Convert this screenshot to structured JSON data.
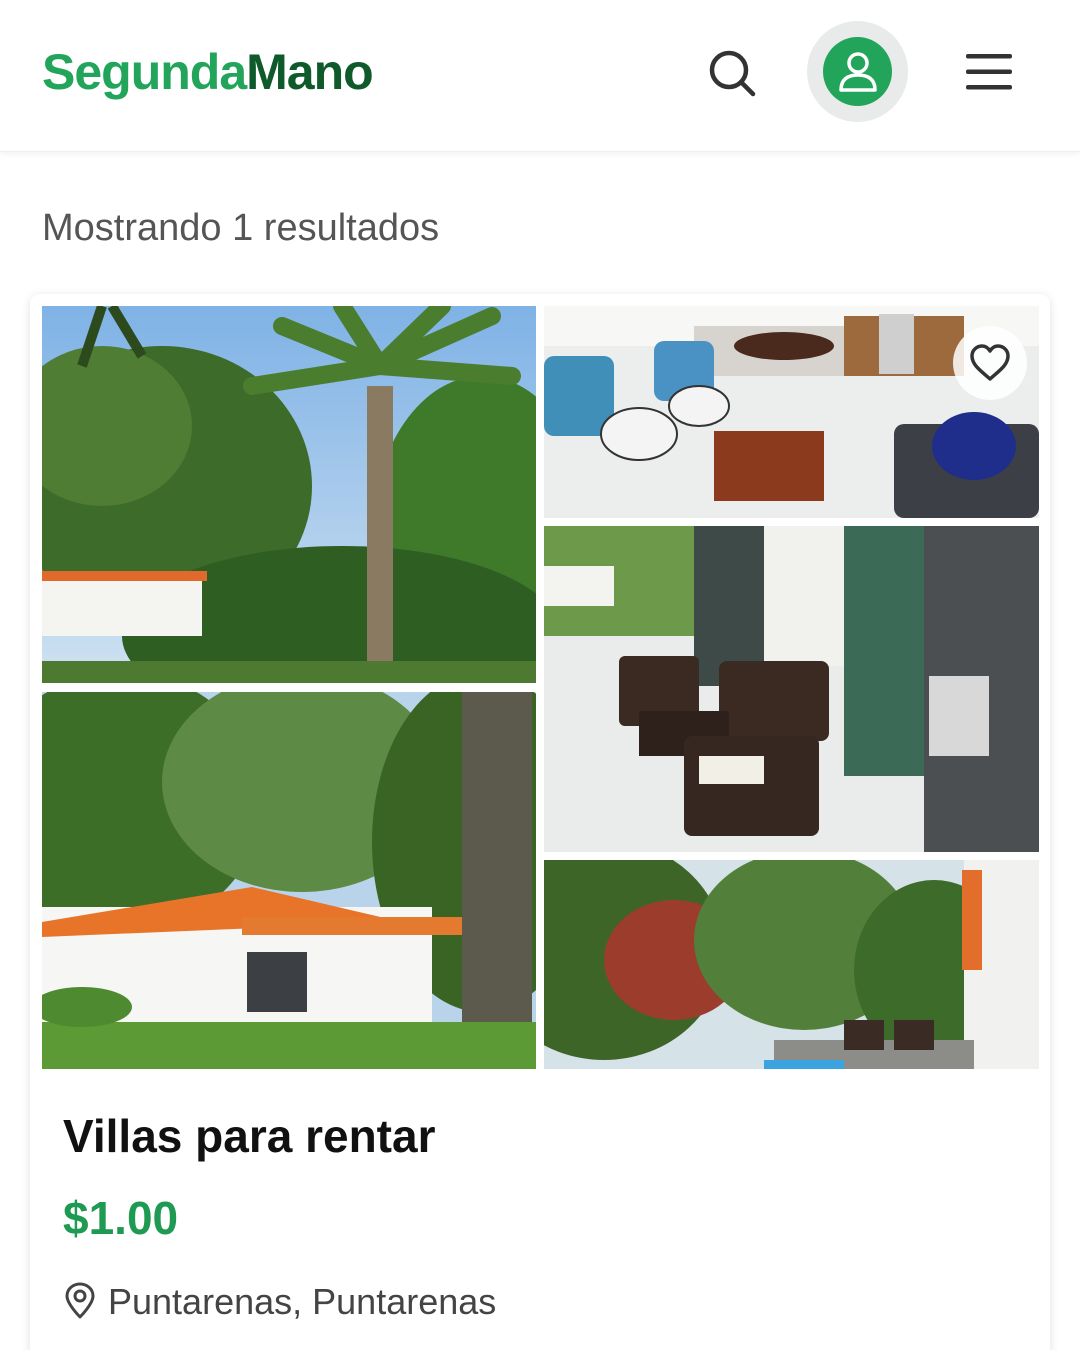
{
  "header": {
    "logo_part1": "Segunda",
    "logo_part2": "Mano",
    "icons": {
      "search": "search-icon",
      "user": "user-icon",
      "menu": "hamburger-menu-icon"
    },
    "colors": {
      "brand_green": "#22a55a",
      "brand_dark_green": "#0f5a2a"
    }
  },
  "results": {
    "text": "Mostrando 1 resultados"
  },
  "listing": {
    "title": "Villas para rentar",
    "price": "$1.00",
    "location": "Puntarenas, Puntarenas",
    "price_color": "#1e9a52",
    "favorite_icon": "heart-icon",
    "location_icon": "map-pin-icon",
    "photos": [
      {
        "name": "photo-palm-trees"
      },
      {
        "name": "photo-living-room"
      },
      {
        "name": "photo-villa-exterior"
      },
      {
        "name": "photo-terrace"
      },
      {
        "name": "photo-garden"
      }
    ]
  }
}
